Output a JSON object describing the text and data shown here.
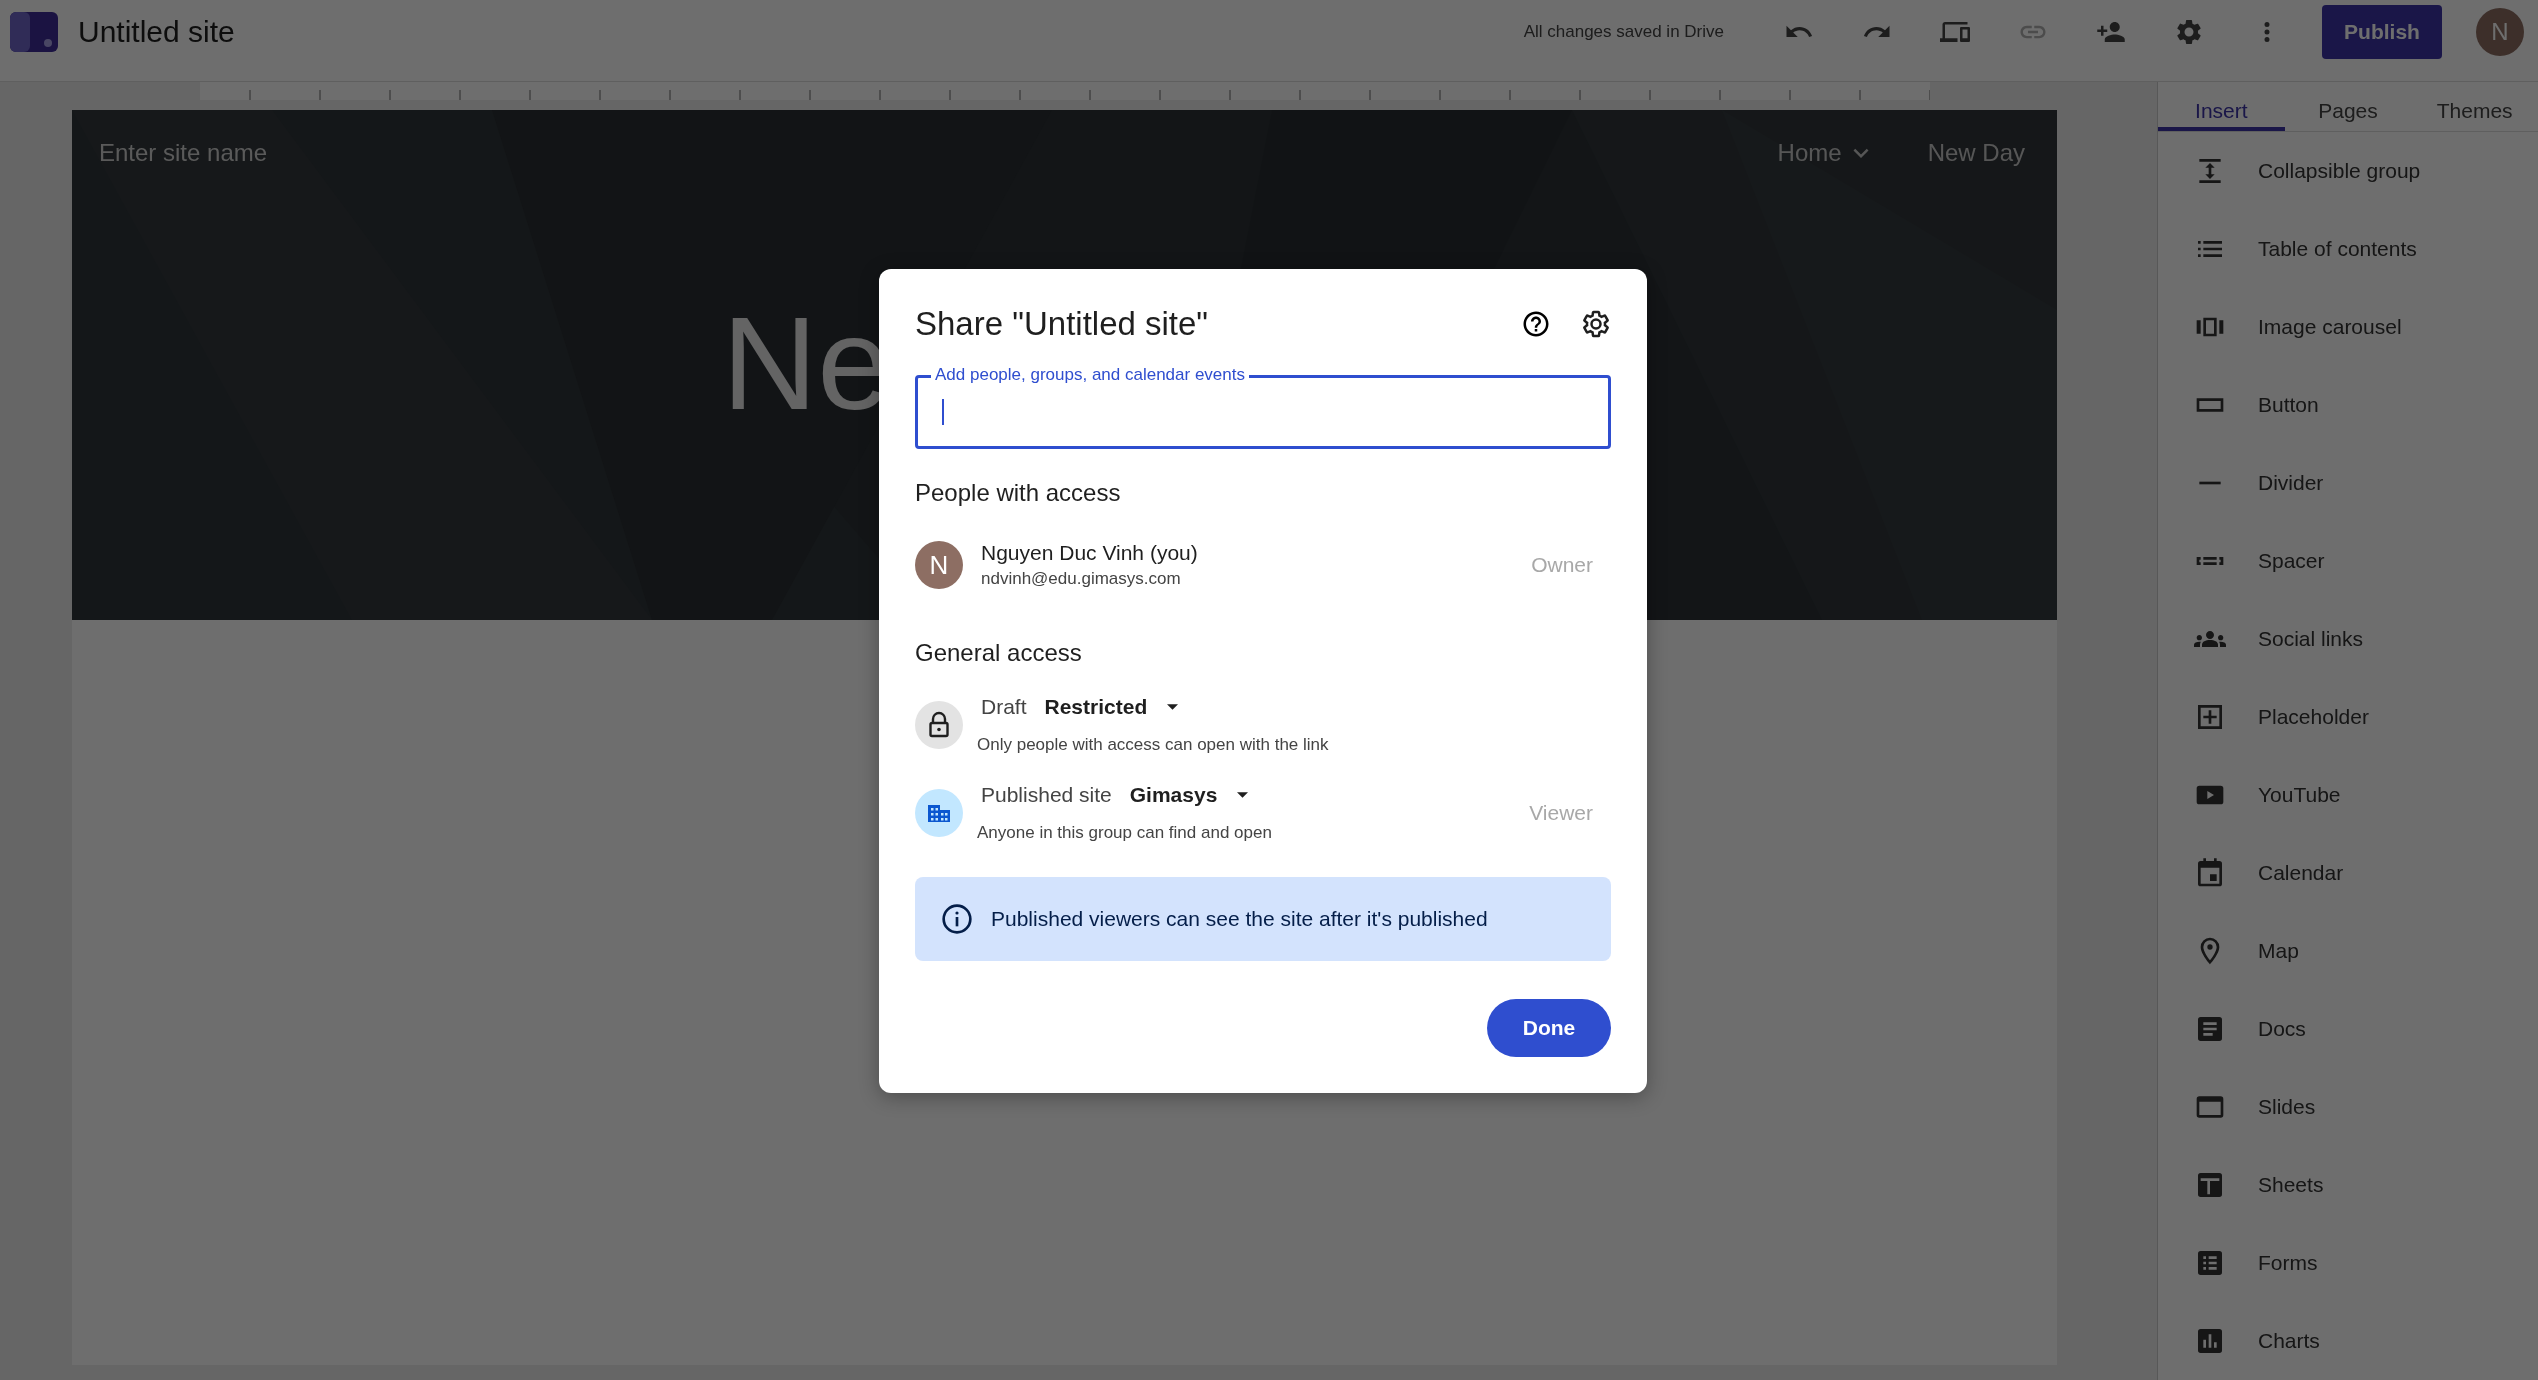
{
  "app_bar": {
    "title": "Untitled site",
    "save_status": "All changes saved in Drive",
    "tools": [
      {
        "kind": "undo",
        "disabled": false
      },
      {
        "kind": "redo",
        "disabled": false
      },
      {
        "kind": "preview",
        "disabled": false
      },
      {
        "kind": "link",
        "disabled": true
      },
      {
        "kind": "share",
        "disabled": false
      },
      {
        "kind": "settings",
        "disabled": false
      },
      {
        "kind": "more",
        "disabled": false
      }
    ],
    "publish": "Publish",
    "avatar": "N"
  },
  "site": {
    "name_placeholder": "Enter site name",
    "nav": [
      {
        "label": "Home",
        "dropdown": true
      },
      {
        "label": "New Day",
        "dropdown": false
      }
    ],
    "hero_title": "Ne"
  },
  "sidebar": {
    "tabs": [
      {
        "label": "Insert",
        "selected": true
      },
      {
        "label": "Pages",
        "selected": false
      },
      {
        "label": "Themes",
        "selected": false
      }
    ],
    "items": [
      {
        "kind": "collapsible",
        "label": "Collapsible group"
      },
      {
        "kind": "toc",
        "label": "Table of contents"
      },
      {
        "kind": "carousel",
        "label": "Image carousel"
      },
      {
        "kind": "button",
        "label": "Button"
      },
      {
        "kind": "divider",
        "label": "Divider"
      },
      {
        "kind": "spacer",
        "label": "Spacer"
      },
      {
        "kind": "social",
        "label": "Social links"
      },
      {
        "kind": "placeholder",
        "label": "Placeholder"
      },
      {
        "kind": "youtube",
        "label": "YouTube"
      },
      {
        "kind": "calendar",
        "label": "Calendar"
      },
      {
        "kind": "map",
        "label": "Map"
      },
      {
        "kind": "docs",
        "label": "Docs"
      },
      {
        "kind": "slides",
        "label": "Slides"
      },
      {
        "kind": "sheets",
        "label": "Sheets"
      },
      {
        "kind": "forms",
        "label": "Forms"
      },
      {
        "kind": "charts",
        "label": "Charts"
      }
    ]
  },
  "dialog": {
    "title": "Share \"Untitled site\"",
    "field_label": "Add people, groups, and calendar events",
    "people_heading": "People with access",
    "person": {
      "initial": "N",
      "name": "Nguyen Duc Vinh (you)",
      "email": "ndvinh@edu.gimasys.com",
      "role": "Owner"
    },
    "general_heading": "General access",
    "access": [
      {
        "kind": "lock",
        "scope": "Draft",
        "value": "Restricted",
        "description": "Only people with access can open with the link"
      },
      {
        "kind": "domain",
        "scope": "Published site",
        "value": "Gimasys",
        "description": "Anyone in this group can find and open",
        "role": "Viewer"
      }
    ],
    "notice": "Published viewers can see the site after it's published",
    "done": "Done"
  }
}
